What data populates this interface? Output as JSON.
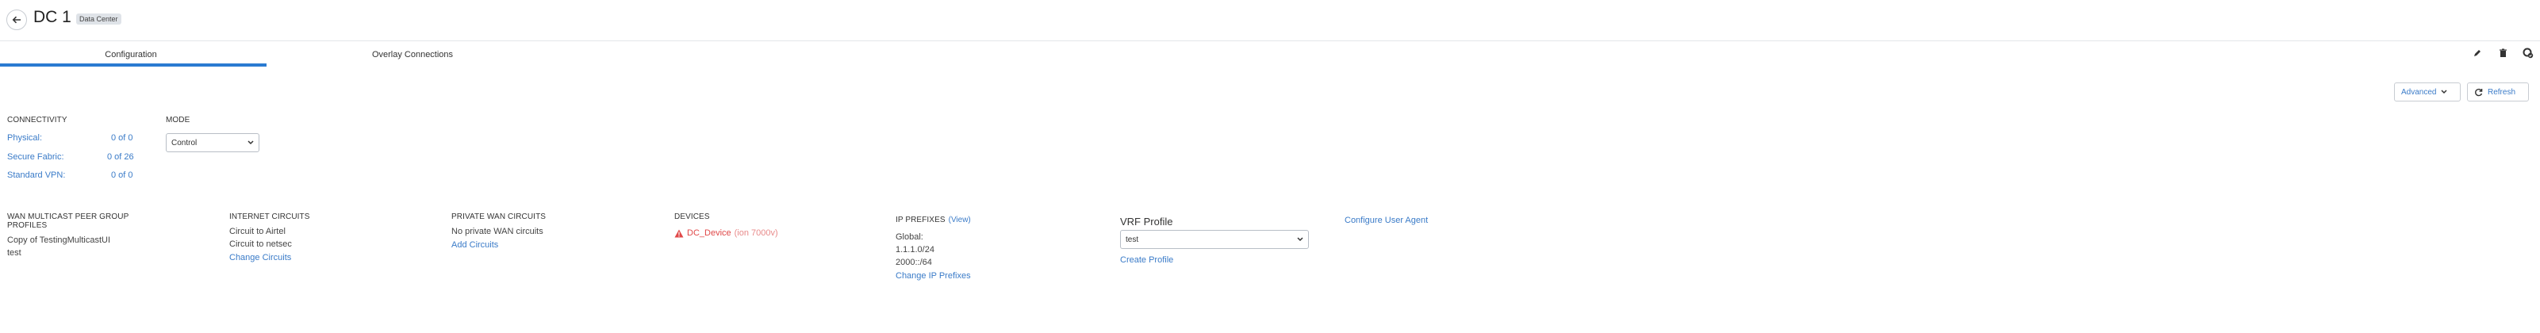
{
  "header": {
    "title": "DC 1",
    "badge": "Data Center"
  },
  "tabs": [
    {
      "label": "Configuration",
      "active": true
    },
    {
      "label": "Overlay Connections",
      "active": false
    }
  ],
  "toolbar": {
    "icons": [
      "pencil-icon",
      "trash-icon",
      "settings-check-icon"
    ],
    "advanced_label": "Advanced",
    "refresh_label": "Refresh"
  },
  "connectivity": {
    "heading": "CONNECTIVITY",
    "rows": [
      {
        "label": "Physical:",
        "value": "0 of 0"
      },
      {
        "label": "Secure Fabric:",
        "value": "0 of 26"
      },
      {
        "label": "Standard VPN:",
        "value": "0 of 0"
      }
    ]
  },
  "mode": {
    "heading": "MODE",
    "selected": "Control"
  },
  "wan_multicast": {
    "heading": "WAN MULTICAST PEER GROUP PROFILES",
    "lines": [
      "Copy of TestingMulticastUI",
      "test"
    ]
  },
  "internet_circuits": {
    "heading": "INTERNET CIRCUITS",
    "lines": [
      "Circuit to Airtel",
      "Circuit to netsec"
    ],
    "action": "Change Circuits"
  },
  "private_wan": {
    "heading": "PRIVATE WAN CIRCUITS",
    "line": "No private WAN circuits",
    "action": "Add Circuits"
  },
  "devices": {
    "heading": "DEVICES",
    "device_name": "DC_Device",
    "device_model": "(ion 7000v)"
  },
  "ip_prefixes": {
    "heading": "IP PREFIXES",
    "view_link": "(View)",
    "lines": [
      "Global:",
      "1.1.1.0/24",
      "2000::/64"
    ],
    "action": "Change IP Prefixes"
  },
  "vrf_profile": {
    "heading": "VRF Profile",
    "selected": "test",
    "action": "Create Profile"
  },
  "user_agent": {
    "link": "Configure User Agent"
  },
  "colors": {
    "accent": "#2a7bd1",
    "link": "#3a7bc8",
    "error": "#e04848"
  }
}
